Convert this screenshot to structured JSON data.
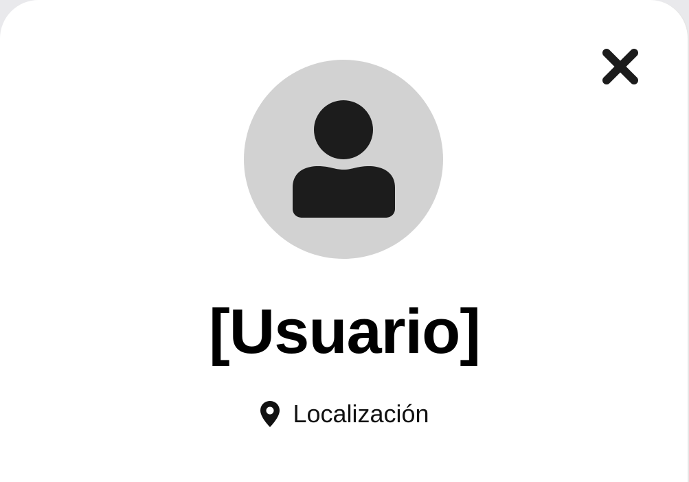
{
  "profile": {
    "name": "[Usuario]",
    "location": "Localización"
  },
  "icons": {
    "close": "close-icon",
    "avatar": "user-icon",
    "location": "map-pin-icon"
  },
  "colors": {
    "background": "#ffffff",
    "avatar_bg": "#d2d2d2",
    "icon": "#1c1c1c",
    "text": "#000000"
  }
}
